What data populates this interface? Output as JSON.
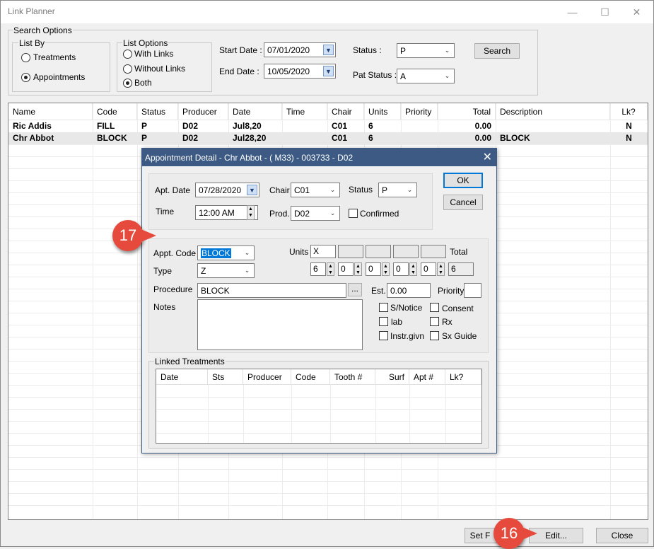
{
  "window": {
    "title": "Link Planner",
    "controls": {
      "minimize": "—",
      "maximize": "☐",
      "close": "✕"
    }
  },
  "search_options": {
    "group_label": "Search Options",
    "list_by": {
      "label": "List By",
      "options": [
        {
          "label": "Treatments",
          "selected": false
        },
        {
          "label": "Appointments",
          "selected": true
        }
      ]
    },
    "list_options": {
      "label": "List Options",
      "options": [
        {
          "label": "With Links",
          "selected": false
        },
        {
          "label": "Without Links",
          "selected": false
        },
        {
          "label": "Both",
          "selected": true
        }
      ]
    },
    "start_date": {
      "label": "Start Date :",
      "value": "07/01/2020"
    },
    "end_date": {
      "label": "End Date :",
      "value": "10/05/2020"
    },
    "status": {
      "label": "Status :",
      "value": "P"
    },
    "pat_status": {
      "label": "Pat Status :",
      "value": "A"
    },
    "search_button": "Search"
  },
  "grid": {
    "columns": [
      "Name",
      "Code",
      "Status",
      "Producer",
      "Date",
      "Time",
      "Chair",
      "Units",
      "Priority",
      "Total",
      "Description",
      "Lk?"
    ],
    "rows": [
      {
        "name": "Ric Addis",
        "code": "FILL",
        "status": "P",
        "producer": "D02",
        "date": "Jul8,20",
        "time": "",
        "chair": "C01",
        "units": "6",
        "priority": "",
        "total": "0.00",
        "description": "",
        "lk": "N"
      },
      {
        "name": "Chr Abbot",
        "code": "BLOCK",
        "status": "P",
        "producer": "D02",
        "date": "Jul28,20",
        "time": "",
        "chair": "C01",
        "units": "6",
        "priority": "",
        "total": "0.00",
        "description": "BLOCK",
        "lk": "N"
      }
    ]
  },
  "dialog": {
    "title": "Appointment Detail - Chr Abbot - ( M33) - 003733 - D02",
    "close": "✕",
    "apt_date": {
      "label": "Apt. Date",
      "value": "07/28/2020"
    },
    "time": {
      "label": "Time",
      "value": "12:00 AM"
    },
    "chair": {
      "label": "Chair",
      "value": "C01"
    },
    "prod": {
      "label": "Prod.",
      "value": "D02"
    },
    "status": {
      "label": "Status",
      "value": "P"
    },
    "confirmed": {
      "label": "Confirmed",
      "checked": false
    },
    "ok_button": "OK",
    "cancel_button": "Cancel",
    "appt_code": {
      "label": "Appt. Code",
      "value": "BLOCK"
    },
    "type": {
      "label": "Type",
      "value": "Z"
    },
    "procedure": {
      "label": "Procedure",
      "value": "BLOCK",
      "browse": "..."
    },
    "notes": {
      "label": "Notes",
      "value": ""
    },
    "units": {
      "label": "Units",
      "first": "X",
      "spinners": [
        "6",
        "0",
        "0",
        "0",
        "0"
      ],
      "total_label": "Total",
      "total_value": "6"
    },
    "est": {
      "label": "Est.",
      "value": "0.00"
    },
    "priority": {
      "label": "Priority",
      "value": ""
    },
    "checkboxes": [
      {
        "label": "S/Notice",
        "checked": false
      },
      {
        "label": "Consent",
        "checked": false
      },
      {
        "label": "lab",
        "checked": false
      },
      {
        "label": "Rx",
        "checked": false
      },
      {
        "label": "Instr.givn",
        "checked": false
      },
      {
        "label": "Sx Guide",
        "checked": false
      }
    ],
    "linked_treatments": {
      "label": "Linked Treatments",
      "columns": [
        "Date",
        "Sts",
        "Producer",
        "Code",
        "Tooth #",
        "Surf",
        "Apt #",
        "Lk?"
      ]
    }
  },
  "bottom_buttons": {
    "set": "Set F",
    "edit": "Edit...",
    "close": "Close"
  },
  "callouts": {
    "step_a": "17",
    "step_b": "16"
  },
  "colors": {
    "dialog_title_bg": "#3c5a83",
    "callout": "#e64a3c",
    "selection": "#0078d7"
  }
}
